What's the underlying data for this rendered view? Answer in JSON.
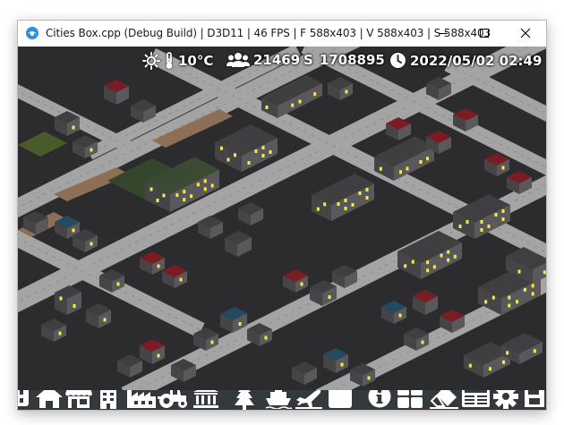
{
  "window": {
    "title": "Cities Box.cpp (Debug Build) | D3D11 | 46 FPS | F 588x403 | V 588x403 | S 588x403",
    "icon": "cities-box-app-icon",
    "controls": [
      "minimize-icon",
      "maximize-icon",
      "close-icon"
    ]
  },
  "hud": {
    "weather_icon": "sun-icon",
    "temperature": "10°C",
    "population": "21469",
    "money_symbol": "S",
    "money": "1708895",
    "datetime": "2022/05/02 02:49"
  },
  "toolbar": {
    "tools": [
      "road-tool-icon",
      "residential-zone-icon",
      "commercial-zone-icon",
      "office-zone-icon",
      "industrial-zone-icon",
      "farm-tractor-icon",
      "government-building-icon",
      "tree-park-icon",
      "ship-icon",
      "airplane-icon",
      "blank-tool-icon",
      "info-icon",
      "overlays-grid-icon",
      "eraser-icon",
      "newspaper-icon",
      "settings-gear-icon",
      "save-disk-icon"
    ]
  },
  "colors": {
    "toolbar_bg": "#34393e",
    "ground": "#2c2c2e",
    "road": "#a4a4a4",
    "window_light": "#f8e74a",
    "roof_red": "#7a1c24",
    "roof_blue": "#244a60",
    "roof_dark": "#3f3f41"
  }
}
